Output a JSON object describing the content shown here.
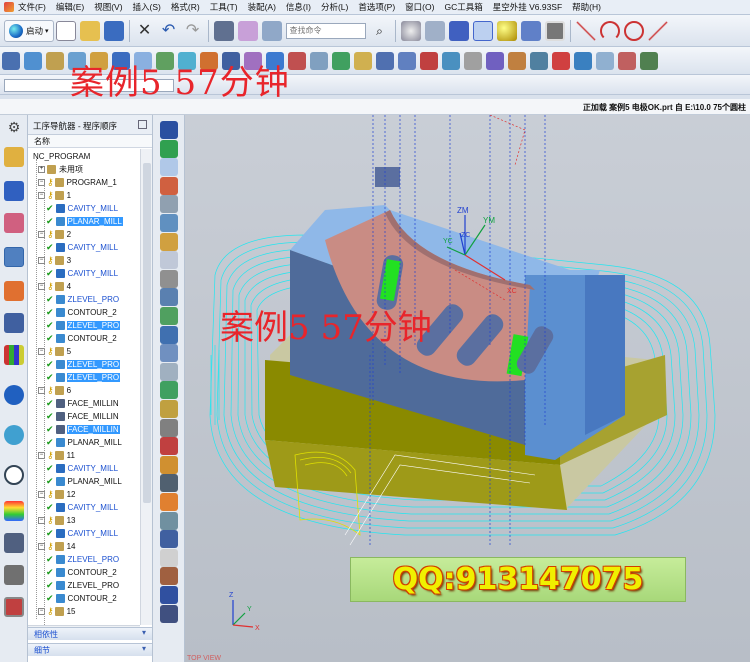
{
  "menu": {
    "items": [
      "文件(F)",
      "编辑(E)",
      "视图(V)",
      "插入(S)",
      "格式(R)",
      "工具(T)",
      "装配(A)",
      "信息(I)",
      "分析(L)",
      "首选项(P)",
      "窗口(O)",
      "GC工具箱",
      "星空外挂 V6.93SF",
      "帮助(H)"
    ]
  },
  "toolbar": {
    "start_label": "启动",
    "find_placeholder": "查找命令"
  },
  "status": {
    "text": "正加载 案例5 电极OK.prt 自 E:\\10.0   75个圆柱"
  },
  "navigator": {
    "title": "工序导航器 - 程序顺序",
    "column_name": "名称",
    "rows": [
      {
        "label": "NC_PROGRAM",
        "level": 0,
        "type": "root"
      },
      {
        "label": "未用项",
        "level": 1,
        "type": "folder"
      },
      {
        "label": "PROGRAM_1",
        "level": 1,
        "type": "program"
      },
      {
        "label": "1",
        "level": 2,
        "type": "group"
      },
      {
        "label": "CAVITY_MILL",
        "level": 3,
        "type": "op",
        "style": "blue"
      },
      {
        "label": "PLANAR_MILL",
        "level": 3,
        "type": "op",
        "style": "sel"
      },
      {
        "label": "2",
        "level": 2,
        "type": "group"
      },
      {
        "label": "CAVITY_MILL",
        "level": 3,
        "type": "op",
        "style": "blue"
      },
      {
        "label": "3",
        "level": 2,
        "type": "group"
      },
      {
        "label": "CAVITY_MILL",
        "level": 3,
        "type": "op",
        "style": "blue"
      },
      {
        "label": "4",
        "level": 2,
        "type": "group"
      },
      {
        "label": "ZLEVEL_PRO",
        "level": 3,
        "type": "op",
        "style": "blue"
      },
      {
        "label": "CONTOUR_2",
        "level": 3,
        "type": "op",
        "style": "plain"
      },
      {
        "label": "ZLEVEL_PRO",
        "level": 3,
        "type": "op",
        "style": "sel"
      },
      {
        "label": "CONTOUR_2",
        "level": 3,
        "type": "op",
        "style": "plain"
      },
      {
        "label": "5",
        "level": 2,
        "type": "group"
      },
      {
        "label": "ZLEVEL_PRO",
        "level": 3,
        "type": "op",
        "style": "sel"
      },
      {
        "label": "ZLEVEL_PRO",
        "level": 3,
        "type": "op",
        "style": "sel"
      },
      {
        "label": "6",
        "level": 2,
        "type": "group"
      },
      {
        "label": "FACE_MILLIN",
        "level": 3,
        "type": "op",
        "style": "plain"
      },
      {
        "label": "FACE_MILLIN",
        "level": 3,
        "type": "op",
        "style": "plain"
      },
      {
        "label": "FACE_MILLIN",
        "level": 3,
        "type": "op",
        "style": "sel"
      },
      {
        "label": "PLANAR_MILL",
        "level": 3,
        "type": "op",
        "style": "plain"
      },
      {
        "label": "11",
        "level": 2,
        "type": "group"
      },
      {
        "label": "CAVITY_MILL",
        "level": 3,
        "type": "op",
        "style": "blue"
      },
      {
        "label": "PLANAR_MILL",
        "level": 3,
        "type": "op",
        "style": "plain"
      },
      {
        "label": "12",
        "level": 2,
        "type": "group"
      },
      {
        "label": "CAVITY_MILL",
        "level": 3,
        "type": "op",
        "style": "blue"
      },
      {
        "label": "13",
        "level": 2,
        "type": "group"
      },
      {
        "label": "CAVITY_MILL",
        "level": 3,
        "type": "op",
        "style": "blue"
      },
      {
        "label": "14",
        "level": 2,
        "type": "group"
      },
      {
        "label": "ZLEVEL_PRO",
        "level": 3,
        "type": "op",
        "style": "blue"
      },
      {
        "label": "CONTOUR_2",
        "level": 3,
        "type": "op",
        "style": "plain"
      },
      {
        "label": "ZLEVEL_PRO",
        "level": 3,
        "type": "op",
        "style": "plain"
      },
      {
        "label": "CONTOUR_2",
        "level": 3,
        "type": "op",
        "style": "plain"
      },
      {
        "label": "15",
        "level": 2,
        "type": "group"
      }
    ],
    "dependency_label": "相依性",
    "detail_label": "细节"
  },
  "viewport": {
    "view_label": "TOP VIEW",
    "axes": {
      "z": "ZM",
      "y": "YM",
      "zc": "ZC",
      "yc": "YC",
      "xc": "XC"
    },
    "triad": {
      "z": "Z",
      "y": "Y",
      "x": "X"
    }
  },
  "watermark": {
    "top": "案例5   57分钟",
    "center": "案例5   57分钟",
    "qq": "QQ:913147075"
  },
  "colors": {
    "toolpath": "#22e6f0",
    "part_block": "#5b8fd0",
    "part_curve": "#c98c84",
    "base": "#8a8a00",
    "selection": "#3399ff",
    "watermark": "#e8252b"
  }
}
